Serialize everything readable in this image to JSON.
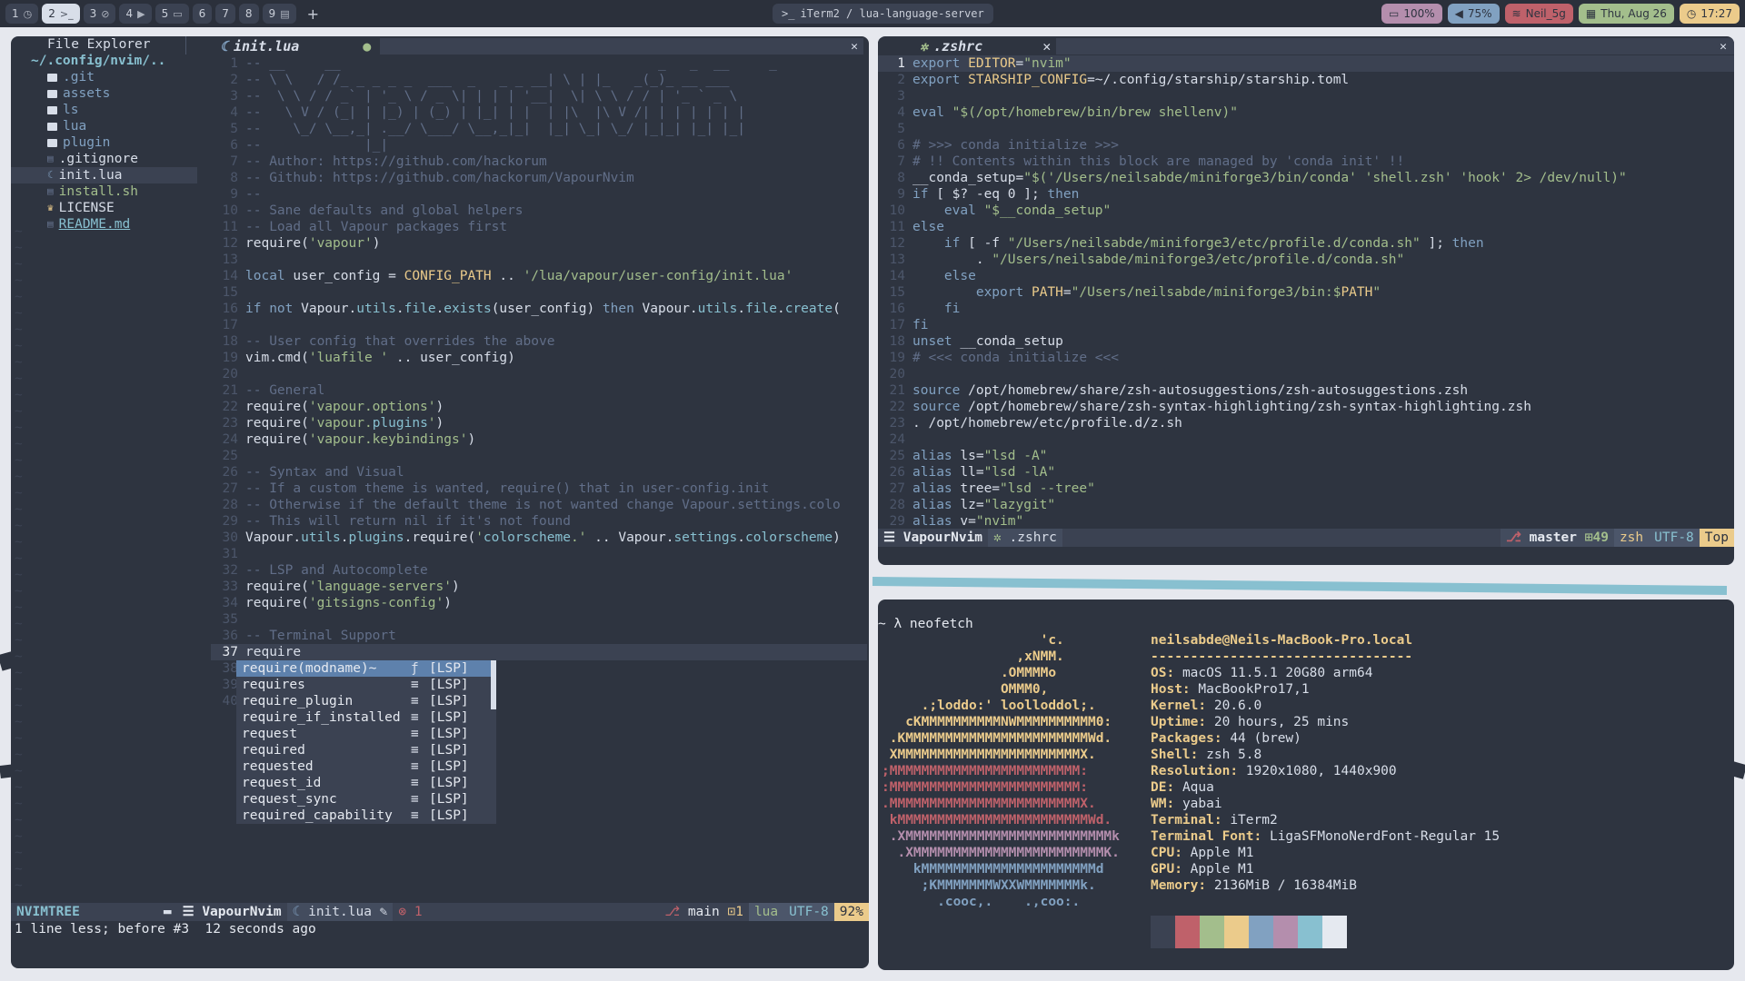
{
  "topbar": {
    "workspaces": [
      {
        "label": "1",
        "glyph": "◷"
      },
      {
        "label": "2",
        "glyph": ">_"
      },
      {
        "label": "3",
        "glyph": "⊘"
      },
      {
        "label": "4",
        "glyph": "▶"
      },
      {
        "label": "5",
        "glyph": "▭"
      },
      {
        "label": "6",
        "glyph": ""
      },
      {
        "label": "7",
        "glyph": ""
      },
      {
        "label": "8",
        "glyph": ""
      },
      {
        "label": "9",
        "glyph": "▤"
      }
    ],
    "active_workspace": "2",
    "add_label": "+",
    "window_title": "iTerm2 / lua-language-server",
    "battery": "100%",
    "volume": "75%",
    "wifi": "Neil_5g",
    "date": "Thu, Aug 26",
    "time": "17:27"
  },
  "nvim_left": {
    "explorer_title": "File Explorer",
    "root_path": "~/.config/nvim/..",
    "tree": [
      {
        "name": ".git",
        "type": "dir"
      },
      {
        "name": "assets",
        "type": "dir"
      },
      {
        "name": "ls",
        "type": "dir"
      },
      {
        "name": "lua",
        "type": "dir"
      },
      {
        "name": "plugin",
        "type": "dir"
      },
      {
        "name": ".gitignore",
        "type": "file"
      },
      {
        "name": "init.lua",
        "type": "file"
      },
      {
        "name": "install.sh",
        "type": "file"
      },
      {
        "name": "LICENSE",
        "type": "file"
      },
      {
        "name": "README.md",
        "type": "file"
      }
    ],
    "tab_name": "init.lua",
    "tab_modified": "●",
    "close_glyph": "✕",
    "code": [
      "-- __     __                                        _   _  __     _",
      "-- \\ \\   / /_ _ _ _ _  ___  _   _ _ __| \\ | |_   _(_)_ __ ___",
      "--  \\ \\ / / _` | '_ \\ / _ \\| | | | '__|  \\| \\ \\ / / | '_ ` _ \\",
      "--   \\ V / (_| | |_) | (_) | |_| | |  | |\\  |\\ V /| | | | | | |",
      "--    \\_/ \\__,_| .__/ \\___/ \\__,_|_|  |_| \\_| \\_/ |_|_| |_| |_|",
      "--             |_|",
      "-- Author: https://github.com/hackorum",
      "-- Github: https://github.com/hackorum/VapourNvim",
      "--",
      "-- Sane defaults and global helpers",
      "-- Load all Vapour packages first",
      "require('vapour')",
      "",
      "local user_config = CONFIG_PATH .. '/lua/vapour/user-config/init.lua'",
      "",
      "if not Vapour.utils.file.exists(user_config) then Vapour.utils.file.create(",
      "",
      "-- User config that overrides the above",
      "vim.cmd('luafile ' .. user_config)",
      "",
      "-- General",
      "require('vapour.options')",
      "require('vapour.plugins')",
      "require('vapour.keybindings')",
      "",
      "-- Syntax and Visual",
      "-- If a custom theme is wanted, require() that in user-config.init",
      "-- Otherwise if the default theme is not wanted change Vapour.settings.colo",
      "-- This will return nil if it's not found",
      "Vapour.utils.plugins.require('colorscheme.' .. Vapour.settings.colorscheme)",
      "",
      "-- LSP and Autocomplete",
      "require('language-servers')",
      "require('gitsigns-config')",
      "",
      "-- Terminal Support",
      "require",
      "",
      "",
      ""
    ],
    "completion": [
      {
        "word": "require(modname)~",
        "kind": "ƒ",
        "src": "[LSP]"
      },
      {
        "word": "requires",
        "kind": "≡",
        "src": "[LSP]"
      },
      {
        "word": "require_plugin",
        "kind": "≡",
        "src": "[LSP]"
      },
      {
        "word": "require_if_installed",
        "kind": "≡",
        "src": "[LSP]"
      },
      {
        "word": "request",
        "kind": "≡",
        "src": "[LSP]"
      },
      {
        "word": "required",
        "kind": "≡",
        "src": "[LSP]"
      },
      {
        "word": "requested",
        "kind": "≡",
        "src": "[LSP]"
      },
      {
        "word": "request_id",
        "kind": "≡",
        "src": "[LSP]"
      },
      {
        "word": "request_sync",
        "kind": "≡",
        "src": "[LSP]"
      },
      {
        "word": "required_capability",
        "kind": "≡",
        "src": "[LSP]"
      }
    ],
    "statusline": {
      "tree_label": "NVIMTREE",
      "project": "VapourNvim",
      "file": "init.lua",
      "errors": "1",
      "branch": "main",
      "changes": "1",
      "filetype": "lua",
      "encoding": "UTF-8",
      "percent": "92%"
    },
    "message": "1 line less; before #3  12 seconds ago"
  },
  "nvim_right": {
    "tab_name": ".zshrc",
    "close_glyph": "✕",
    "code": [
      "export EDITOR=\"nvim\"",
      "export STARSHIP_CONFIG=~/.config/starship/starship.toml",
      "",
      "eval \"$(/opt/homebrew/bin/brew shellenv)\"",
      "",
      "# >>> conda initialize >>>",
      "# !! Contents within this block are managed by 'conda init' !!",
      "__conda_setup=\"$('/Users/neilsabde/miniforge3/bin/conda' 'shell.zsh' 'hook' 2> /dev/null)\"",
      "if [ $? -eq 0 ]; then",
      "    eval \"$__conda_setup\"",
      "else",
      "    if [ -f \"/Users/neilsabde/miniforge3/etc/profile.d/conda.sh\" ]; then",
      "        . \"/Users/neilsabde/miniforge3/etc/profile.d/conda.sh\"",
      "    else",
      "        export PATH=\"/Users/neilsabde/miniforge3/bin:$PATH\"",
      "    fi",
      "fi",
      "unset __conda_setup",
      "# <<< conda initialize <<<",
      "",
      "source /opt/homebrew/share/zsh-autosuggestions/zsh-autosuggestions.zsh",
      "source /opt/homebrew/share/zsh-syntax-highlighting/zsh-syntax-highlighting.zsh",
      ". /opt/homebrew/etc/profile.d/z.sh",
      "",
      "alias ls=\"lsd -A\"",
      "alias ll=\"lsd -lA\"",
      "alias tree=\"lsd --tree\"",
      "alias lz=\"lazygit\"",
      "alias v=\"nvim\""
    ],
    "statusline": {
      "project": "VapourNvim",
      "file": ".zshrc",
      "branch": "master",
      "changes": "49",
      "filetype": "zsh",
      "encoding": "UTF-8",
      "position": "Top"
    }
  },
  "terminal": {
    "prompt": "~ λ neofetch",
    "user_host": "neilsabde@Neils-MacBook-Pro.local",
    "separator": "---------------------------------",
    "logo": [
      "                    'c.",
      "                 ,xNMM.",
      "               .OMMMMo",
      "               OMMM0,",
      "     .;loddo:' loolloddol;.",
      "   cKMMMMMMMMMMNWMMMMMMMMMM0:",
      " .KMMMMMMMMMMMMMMMMMMMMMMMWd.",
      " XMMMMMMMMMMMMMMMMMMMMMMMX.",
      ";MMMMMMMMMMMMMMMMMMMMMMMM:",
      ":MMMMMMMMMMMMMMMMMMMMMMMM:",
      ".MMMMMMMMMMMMMMMMMMMMMMMMX.",
      " kMMMMMMMMMMMMMMMMMMMMMMMMWd.",
      " .XMMMMMMMMMMMMMMMMMMMMMMMMMMk",
      "  .XMMMMMMMMMMMMMMMMMMMMMMMMK.",
      "    kMMMMMMMMMMMMMMMMMMMMMMd",
      "     ;KMMMMMMMWXXWMMMMMMMk.",
      "       .cooc,.    .,coo:."
    ],
    "info": [
      {
        "key": "OS",
        "val": "macOS 11.5.1 20G80 arm64"
      },
      {
        "key": "Host",
        "val": "MacBookPro17,1"
      },
      {
        "key": "Kernel",
        "val": "20.6.0"
      },
      {
        "key": "Uptime",
        "val": "20 hours, 25 mins"
      },
      {
        "key": "Packages",
        "val": "44 (brew)"
      },
      {
        "key": "Shell",
        "val": "zsh 5.8"
      },
      {
        "key": "Resolution",
        "val": "1920x1080, 1440x900"
      },
      {
        "key": "DE",
        "val": "Aqua"
      },
      {
        "key": "WM",
        "val": "yabai"
      },
      {
        "key": "Terminal",
        "val": "iTerm2"
      },
      {
        "key": "Terminal Font",
        "val": "LigaSFMonoNerdFont-Regular 15"
      },
      {
        "key": "CPU",
        "val": "Apple M1"
      },
      {
        "key": "GPU",
        "val": "Apple M1"
      },
      {
        "key": "Memory",
        "val": "2136MiB / 16384MiB"
      }
    ],
    "swatches": [
      "#3b4252",
      "#bf616a",
      "#a3be8c",
      "#ebcb8b",
      "#81a1c1",
      "#b48ead",
      "#88c0d0",
      "#e5e9f0"
    ]
  },
  "colors": {
    "bg": "#2e3440",
    "accent": "#88c0d0",
    "yellow": "#ebcb8b",
    "green": "#a3be8c",
    "red": "#bf616a"
  }
}
